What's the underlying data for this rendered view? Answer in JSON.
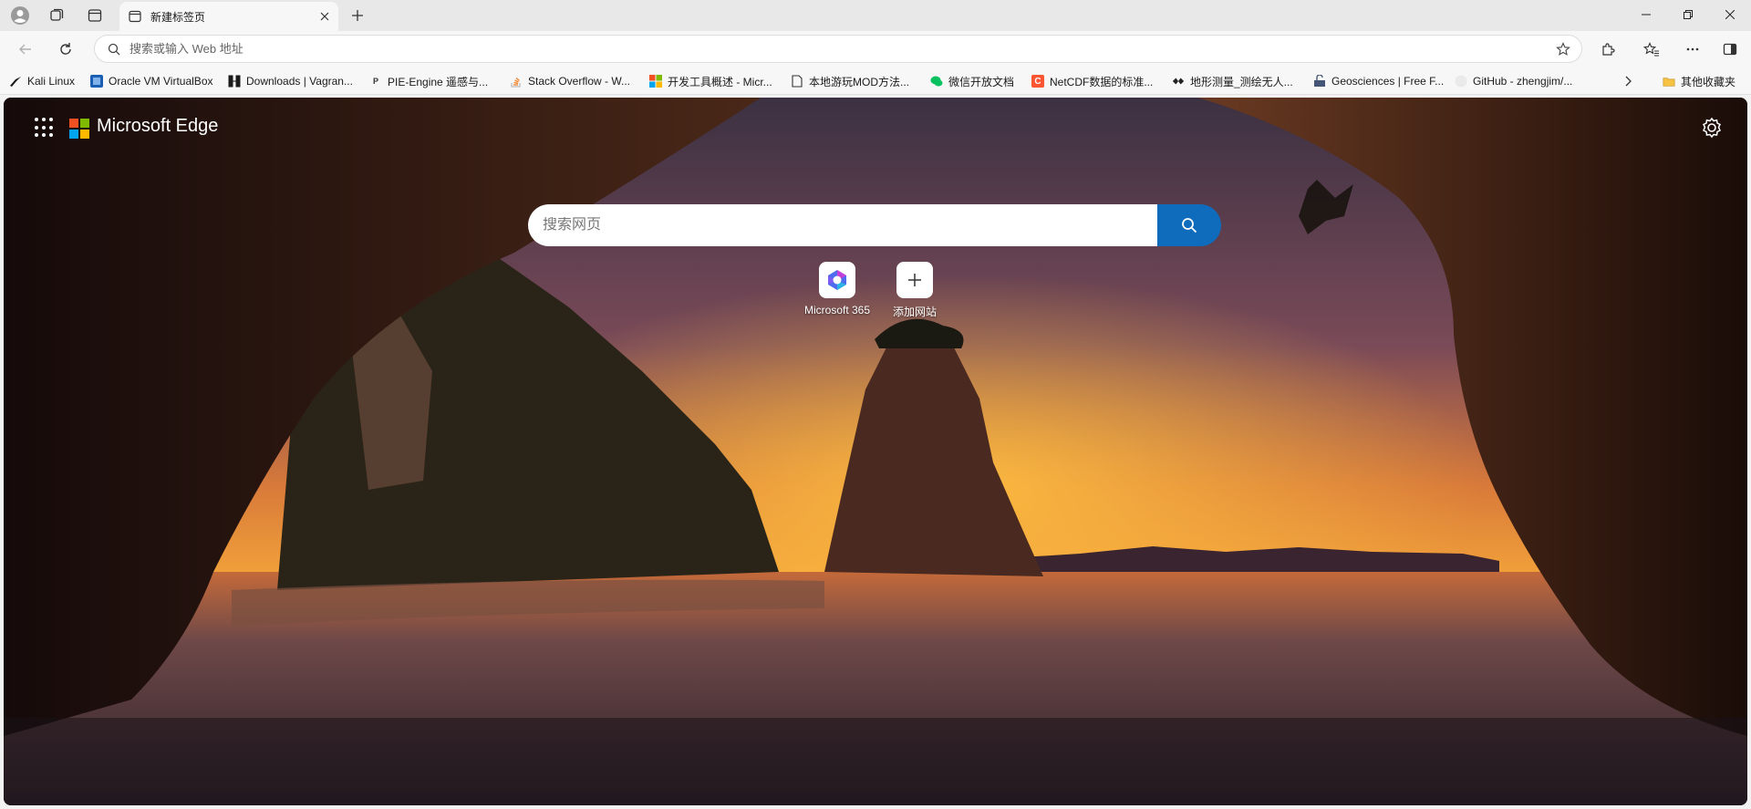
{
  "tab": {
    "title": "新建标签页"
  },
  "omnibox": {
    "placeholder": "搜索或输入 Web 地址"
  },
  "bookmarks": {
    "items": [
      {
        "label": "Kali Linux",
        "icon": "kali-icon"
      },
      {
        "label": "Oracle VM VirtualBox",
        "icon": "virtualbox-icon"
      },
      {
        "label": "Downloads | Vagran...",
        "icon": "vagrant-icon"
      },
      {
        "label": "PIE-Engine 遥感与...",
        "icon": "pie-engine-icon"
      },
      {
        "label": "Stack Overflow - W...",
        "icon": "stackoverflow-icon"
      },
      {
        "label": "开发工具概述 - Micr...",
        "icon": "microsoft-icon"
      },
      {
        "label": "本地游玩MOD方法...",
        "icon": "page-icon"
      },
      {
        "label": "微信开放文档",
        "icon": "wechat-icon"
      },
      {
        "label": "NetCDF数据的标准...",
        "icon": "csdn-icon"
      },
      {
        "label": "地形测量_测绘无人...",
        "icon": "dji-icon"
      },
      {
        "label": "Geosciences | Free F...",
        "icon": "geosciences-icon"
      },
      {
        "label": "GitHub - zhengjim/...",
        "icon": "github-icon"
      }
    ],
    "other_folder": "其他收藏夹"
  },
  "ntp": {
    "brand": "Microsoft Edge",
    "search_placeholder": "搜索网页",
    "tiles": [
      {
        "label": "Microsoft 365",
        "icon": "microsoft365-icon"
      },
      {
        "label": "添加网站",
        "icon": "add-icon"
      }
    ]
  },
  "colors": {
    "accent": "#0f6cbd",
    "ms_red": "#f25022",
    "ms_green": "#7fba00",
    "ms_blue": "#00a4ef",
    "ms_yellow": "#ffb900"
  }
}
